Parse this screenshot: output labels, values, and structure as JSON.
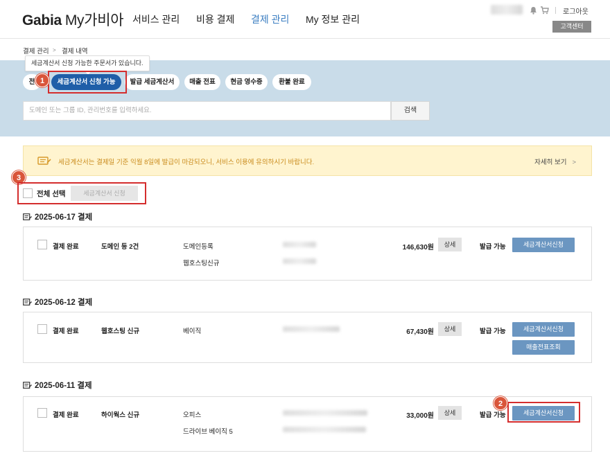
{
  "header": {
    "logo_brand": "Gabia",
    "logo_sub": "My가비아",
    "nav": [
      "서비스 관리",
      "비용 결제",
      "결제 관리",
      "My 정보 관리"
    ],
    "active_nav": "결제 관리",
    "logout": "로그아웃",
    "support": "고객센터"
  },
  "breadcrumb": [
    "결제 관리",
    "결제 내역"
  ],
  "filters": {
    "tooltip": "세금계산서 신청 가능한 주문서가 있습니다.",
    "chips": [
      "전",
      "세금계산서 신청 가능",
      "발급 세금계산서",
      "매출 전표",
      "현금 영수증",
      "환불 완료"
    ],
    "active_chip": "세금계산서 신청 가능",
    "search_placeholder": "도메인 또는 그룹 ID, 관리번호를 입력하세요.",
    "search_button": "검색"
  },
  "notice": {
    "text": "세금계산서는 결제일 기준 익월 8일에 발급이 마감되오니, 서비스 이용에 유의하시기 바랍니다.",
    "link": "자세히 보기"
  },
  "bulk": {
    "select_all": "전체 선택",
    "apply_button": "세금계산서 신청"
  },
  "markers": [
    "1",
    "2",
    "3"
  ],
  "groups": [
    {
      "date": "2025-06-17 결제",
      "status": "결제 완료",
      "title": "도메인 등 2건",
      "items": [
        "도메인등록",
        "웹호스팅신규"
      ],
      "amount": "146,630원",
      "detail": "상세",
      "issue_status": "발급 가능",
      "buttons": [
        "세금계산서신청"
      ]
    },
    {
      "date": "2025-06-12 결제",
      "status": "결제 완료",
      "title": "웹호스팅 신규",
      "items": [
        "베이직"
      ],
      "amount": "67,430원",
      "detail": "상세",
      "issue_status": "발급 가능",
      "buttons": [
        "세금계산서신청",
        "매출전표조회"
      ]
    },
    {
      "date": "2025-06-11 결제",
      "status": "결제 완료",
      "title": "하이웍스 신규",
      "items": [
        "오피스",
        "드라이브 베이직 5"
      ],
      "amount": "33,000원",
      "detail": "상세",
      "issue_status": "발급 가능",
      "buttons": [
        "세금계산서신청"
      ]
    }
  ],
  "colors": {
    "accent_blue": "#1f5ea8",
    "button_blue": "#6b96c1",
    "band": "#c9dce9",
    "highlight_red": "#d42d2d",
    "notice_text": "#c98a1a"
  }
}
